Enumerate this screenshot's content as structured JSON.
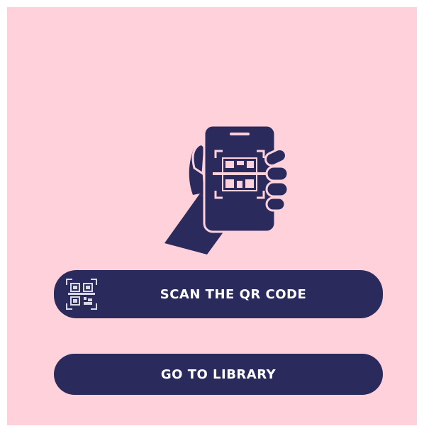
{
  "illustration": {
    "icon": "hand-holding-phone-scanning-qr-icon"
  },
  "buttons": {
    "scan_label": "SCAN THE QR CODE",
    "scan_icon": "qr-code-icon",
    "library_label": "GO TO LIBRARY"
  },
  "colors": {
    "background": "#ffd1da",
    "primary": "#2b2a5c",
    "text_on_primary": "#ffffff"
  }
}
